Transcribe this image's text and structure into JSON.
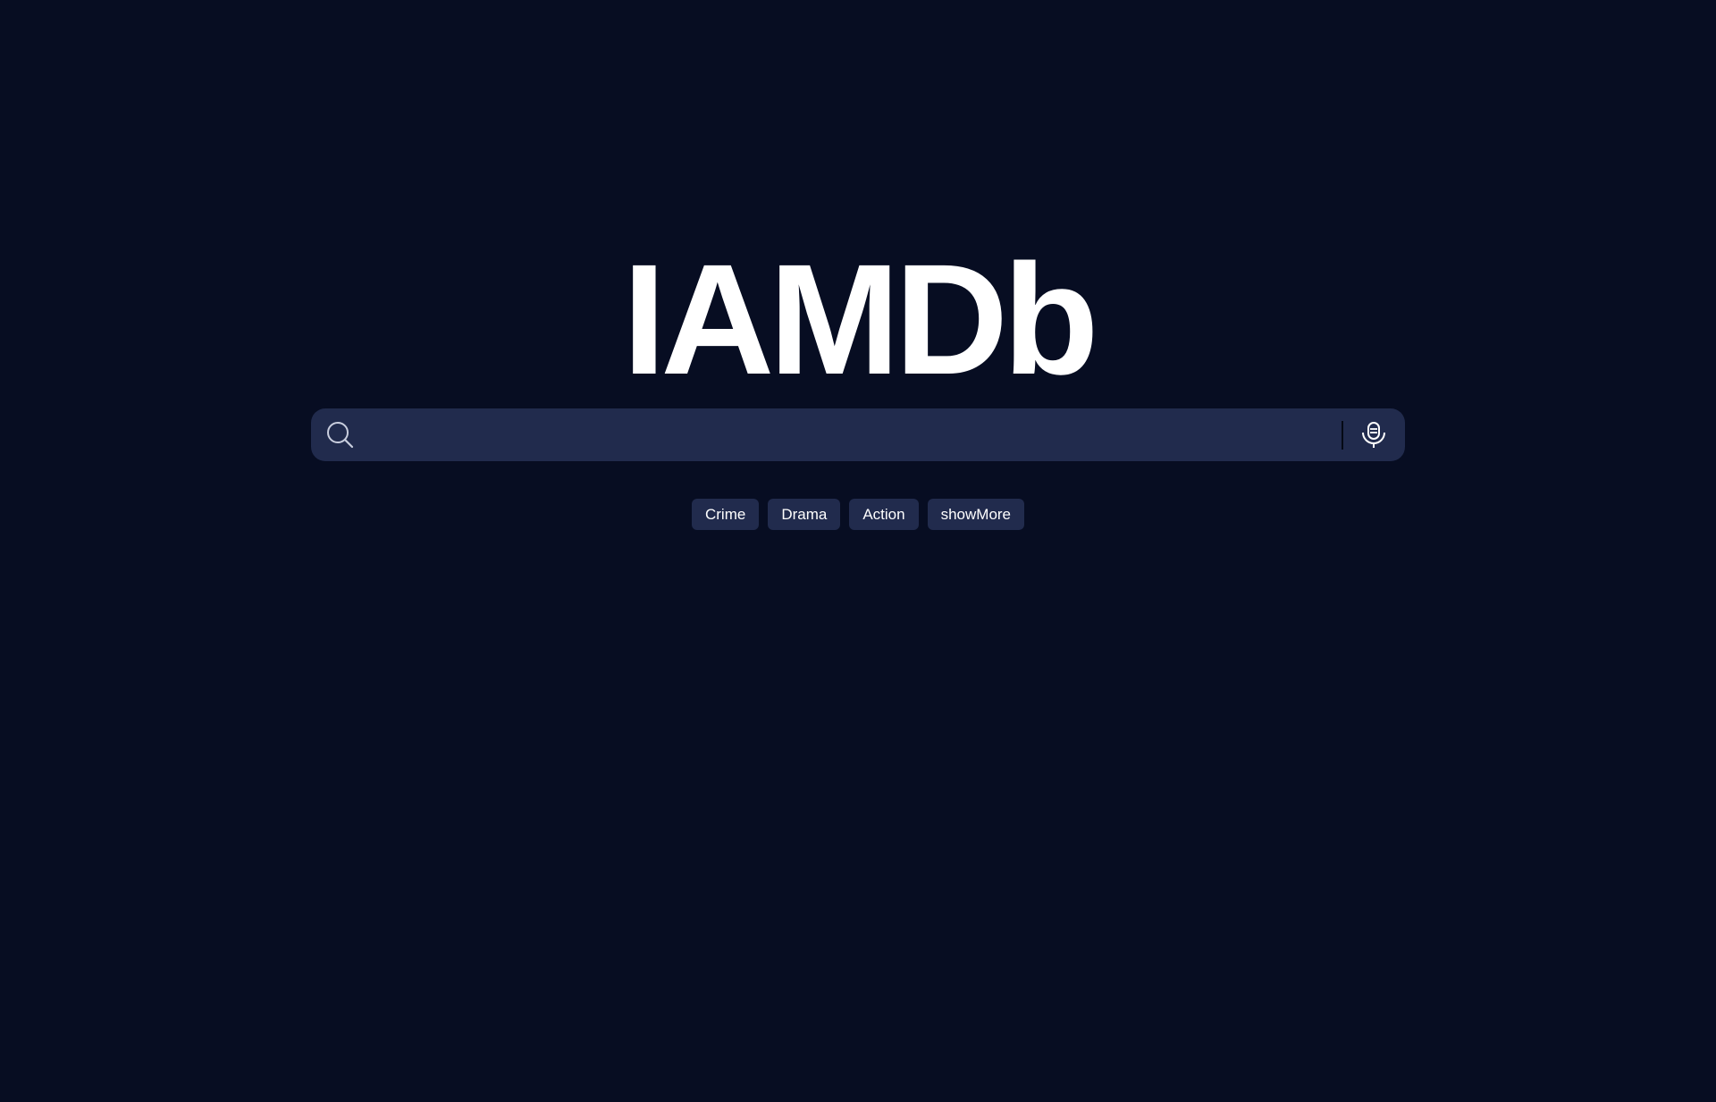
{
  "logo": {
    "text": "IAMDb"
  },
  "search": {
    "value": "",
    "placeholder": ""
  },
  "icons": {
    "search": "search-icon",
    "mic": "microphone-icon"
  },
  "genres": [
    "Crime",
    "Drama",
    "Action"
  ],
  "show_more_label": "showMore",
  "colors": {
    "background": "#070d22",
    "surface": "#212b4d",
    "text": "#ffffff",
    "icon": "#c9cede"
  }
}
